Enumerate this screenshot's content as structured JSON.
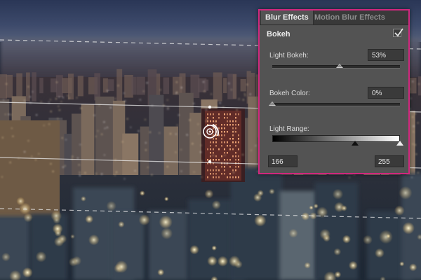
{
  "canvas": {
    "description_icon": "blur-pin-icon"
  },
  "panel": {
    "tabs": [
      {
        "label": "Blur Effects",
        "active": true
      },
      {
        "label": "Motion Blur Effects",
        "active": false
      }
    ],
    "bokeh": {
      "title": "Bokeh",
      "checked": true,
      "light_bokeh": {
        "label": "Light Bokeh:",
        "value": "53%",
        "level": 0.53
      },
      "bokeh_color": {
        "label": "Bokeh Color:",
        "value": "0%",
        "level": 0.0
      },
      "light_range": {
        "label": "Light Range:",
        "low": "166",
        "high": "255",
        "low_level": 0.651,
        "high_level": 1.0
      }
    }
  },
  "colors": {
    "accent_border": "#d1277e",
    "panel_bg": "#535353",
    "tab_bar": "#393939"
  }
}
